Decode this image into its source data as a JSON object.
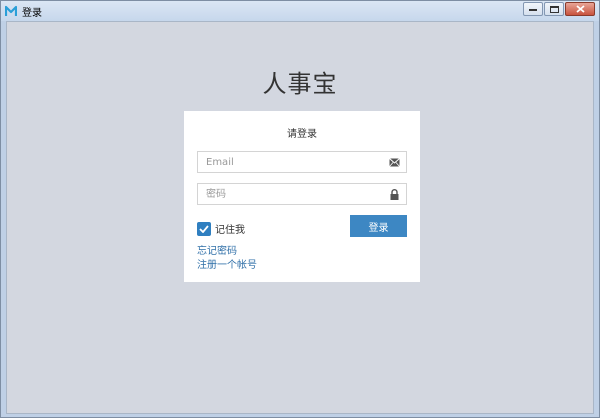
{
  "window": {
    "title": "登录",
    "buttons": [
      "minimize",
      "maximize",
      "close"
    ]
  },
  "brand": {
    "name": "人事宝"
  },
  "login_card": {
    "heading": "请登录",
    "email": {
      "placeholder": "Email",
      "value": "",
      "icon": "envelope-icon"
    },
    "password": {
      "placeholder": "密码",
      "value": "",
      "icon": "lock-icon"
    },
    "remember": {
      "label": "记住我",
      "checked": true
    },
    "submit_label": "登录",
    "links": {
      "forgot": "忘记密码",
      "register": "注册一个帐号"
    }
  },
  "colors": {
    "accent": "#3d87c3",
    "link": "#2f6fa8",
    "background": "#d3d7e0",
    "card": "#ffffff"
  }
}
